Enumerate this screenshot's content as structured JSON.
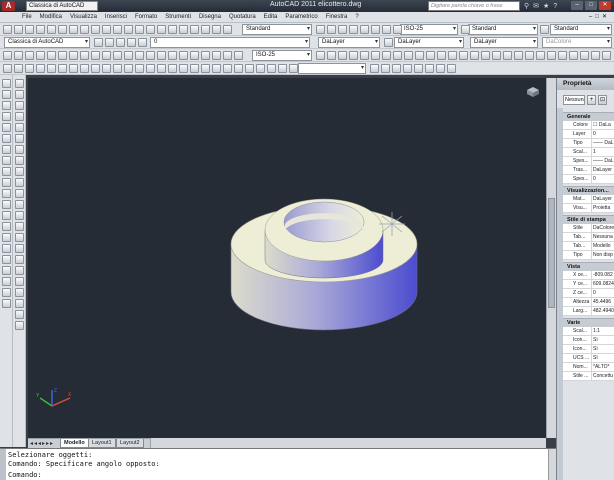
{
  "app": {
    "logo_letter": "A",
    "workspace": "Classica di AutoCAD",
    "title": "AutoCAD 2011   elicottero.dwg",
    "search_placeholder": "Digitare parola chiave o frase"
  },
  "menu": [
    "File",
    "Modifica",
    "Visualizza",
    "Inserisci",
    "Formato",
    "Strumenti",
    "Disegna",
    "Quotatura",
    "Edita",
    "Parametrico",
    "Finestra",
    "?"
  ],
  "toolbars": {
    "text_style": "Standard",
    "dim_style": "ISO-25",
    "table_style": "Standard",
    "multileader_style": "Standard",
    "workspace2": "Classica di AutoCAD",
    "layer": "0",
    "color": "DaLayer",
    "linetype": "DaLayer",
    "lineweight": "DaLayer",
    "plotstyle": "DaColore",
    "dim_style2": "ISO-25"
  },
  "tabs": {
    "items": [
      "Modello",
      "Layout1",
      "Layout2"
    ],
    "active": 0
  },
  "command": {
    "lines": [
      "Selezionare oggetti:",
      "Comando: Specificare angolo opposto:"
    ],
    "prompt": "Comando:"
  },
  "properties": {
    "title": "Proprietà",
    "selection": "Nessuna",
    "sections": [
      {
        "name": "Generale",
        "rows": [
          {
            "k": "Colore",
            "v": "☐ DaLa"
          },
          {
            "k": "Layer",
            "v": "0"
          },
          {
            "k": "Tipo",
            "v": "—— DaL"
          },
          {
            "k": "Scal...",
            "v": "1"
          },
          {
            "k": "Spes...",
            "v": "—— DaL"
          },
          {
            "k": "Tras...",
            "v": "DaLayer"
          },
          {
            "k": "Spes...",
            "v": "0"
          }
        ]
      },
      {
        "name": "Visualizzazion...",
        "rows": [
          {
            "k": "Mat...",
            "v": "DaLayer"
          },
          {
            "k": "Visu...",
            "v": "Proietta"
          }
        ]
      },
      {
        "name": "Stile di stampa",
        "rows": [
          {
            "k": "Stile",
            "v": "DaColore"
          },
          {
            "k": "Tab...",
            "v": "Nessuna"
          },
          {
            "k": "Tab...",
            "v": "Modello"
          },
          {
            "k": "Tipo",
            "v": "Non disp"
          }
        ]
      },
      {
        "name": "Vista",
        "rows": [
          {
            "k": "X ce...",
            "v": "-809.082"
          },
          {
            "k": "Y ce...",
            "v": "609.0824"
          },
          {
            "k": "Z ce...",
            "v": "0"
          },
          {
            "k": "Altezza",
            "v": "45.4496"
          },
          {
            "k": "Larg...",
            "v": "482.4940"
          }
        ]
      },
      {
        "name": "Varie",
        "rows": [
          {
            "k": "Scal...",
            "v": "1:1"
          },
          {
            "k": "Icon...",
            "v": "Sì"
          },
          {
            "k": "Icon...",
            "v": "Sì"
          },
          {
            "k": "UCS ...",
            "v": "Sì"
          },
          {
            "k": "Nom...",
            "v": "*ALTO*"
          },
          {
            "k": "Stile ...",
            "v": "Concettu"
          }
        ]
      }
    ]
  },
  "colors": {
    "canvas": "#262c36",
    "object_light": "#eeeed6",
    "object_shade": "#5a5ad2"
  }
}
